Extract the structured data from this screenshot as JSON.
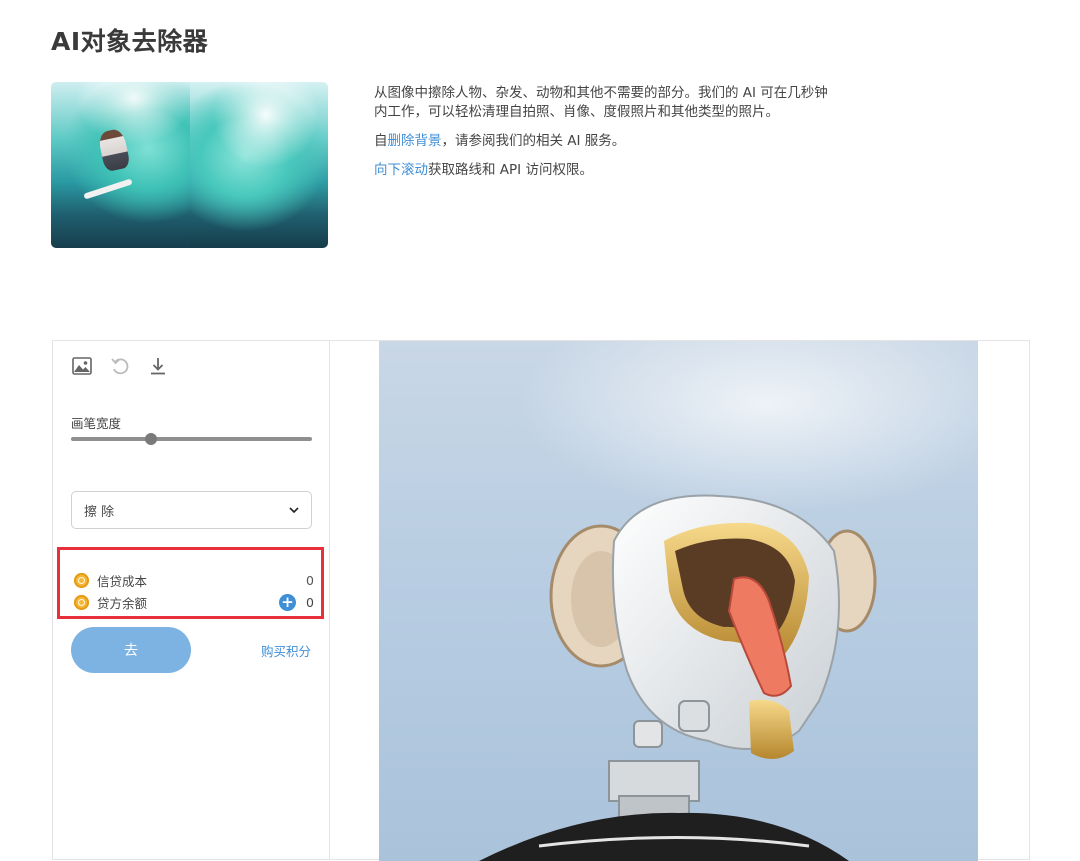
{
  "page": {
    "title": "AI对象去除器"
  },
  "description": {
    "paragraph1": "从图像中擦除人物、杂发、动物和其他不需要的部分。我们的 AI 可在几秒钟内工作，可以轻松清理自拍照、肖像、度假照片和其他类型的照片。",
    "paragraph2_prefix": "自",
    "paragraph2_link": "删除背景",
    "paragraph2_suffix": "，请参阅我们的相关 AI 服务。",
    "paragraph3_link": "向下滚动",
    "paragraph3_suffix": "获取路线和 API 访问权限。"
  },
  "toolbar": {
    "icons": [
      "image-icon",
      "undo-icon",
      "download-icon"
    ]
  },
  "brush": {
    "label": "画笔宽度",
    "value_fraction": 0.33
  },
  "mode_select": {
    "selected": "擦 除"
  },
  "credits": {
    "cost_label": "信贷成本",
    "cost_value": "0",
    "balance_label": "贷方余额",
    "balance_value": "0"
  },
  "actions": {
    "go_label": "去",
    "buy_label": "购买积分"
  },
  "colors": {
    "accent": "#3f8fd6",
    "go_button": "#7db3e2",
    "highlight": "#e8303a",
    "coin": "#f4b73a"
  }
}
